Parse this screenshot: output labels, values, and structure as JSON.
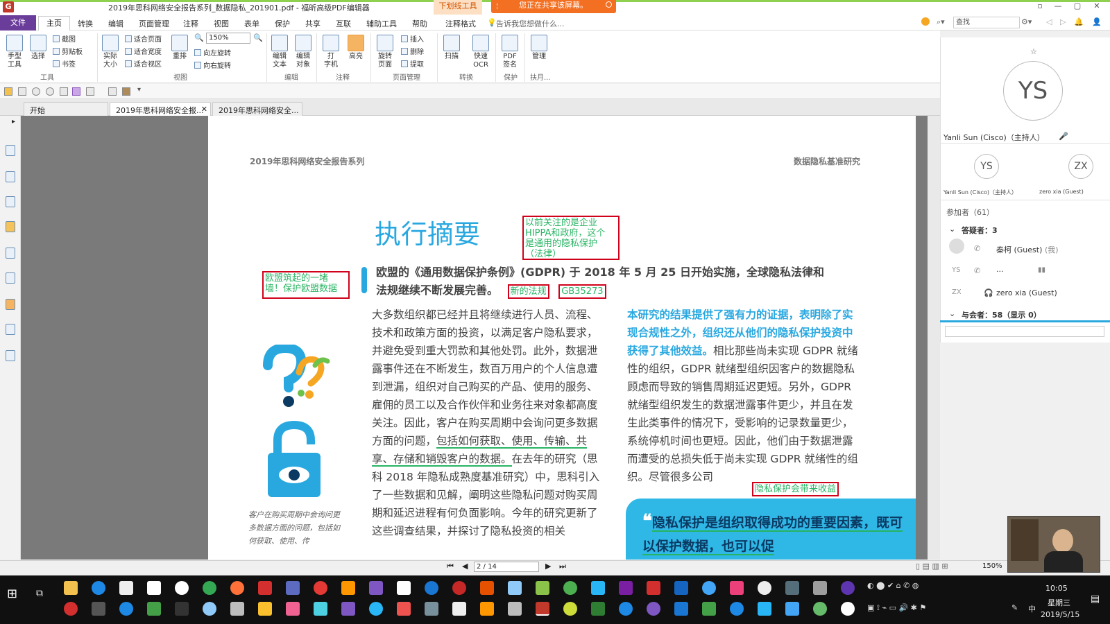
{
  "window": {
    "title": "2019年思科网络安全报告系列_数据隐私_201901.pdf - 福昕高级PDF编辑器",
    "context_tab": "下划线工具",
    "share_banner": "您正在共享该屏幕。"
  },
  "menu": {
    "file": "文件",
    "items": [
      "主页",
      "转换",
      "编辑",
      "页面管理",
      "注释",
      "视图",
      "表单",
      "保护",
      "共享",
      "互联",
      "辅助工具",
      "帮助",
      "注释格式"
    ],
    "tell_me": "告诉我您想做什么...",
    "search_placeholder": "查找"
  },
  "ribbon": {
    "hand_tool": "手型\n工具",
    "select": "选择",
    "screenshot": "截图",
    "clipboard": "剪贴板",
    "bookmark": "书签",
    "actual_size": "实际\n大小",
    "fit_page": "适合页面",
    "fit_width": "适合宽度",
    "fit_view": "适合视区",
    "reflow": "重排",
    "zoom_value": "150%",
    "rotate_left": "向左旋转",
    "rotate_right": "向右旋转",
    "edit_text": "编辑\n文本",
    "edit_object": "编辑\n对象",
    "typewriter": "打\n字机",
    "highlight": "高亮",
    "rotate_page": "旋转\n页面",
    "insert": "插入",
    "delete": "删除",
    "extract": "提取",
    "scan": "扫描",
    "quick_ocr": "快速\nOCR",
    "pdf_sign": "PDF\n签名",
    "manage": "管理",
    "groups": {
      "tools": "工具",
      "view": "视图",
      "edit": "编辑",
      "annotation": "注释",
      "page_mgmt": "页面管理",
      "convert": "转换",
      "protect": "保护",
      "extra": "扶月..."
    }
  },
  "doc_tabs": [
    "开始",
    "2019年思科网络安全报...",
    "2019年思科网络安全..."
  ],
  "page": {
    "header_left": "2019年思科网络安全报告系列",
    "header_right": "数据隐私基准研究",
    "title": "执行摘要",
    "lead_line1": "欧盟的《通用数据保护条例》(GDPR) 于 2018 年 5 月 25 日开始实施，全球隐私法律和",
    "lead_line2": "法规继续不断发展完善。",
    "annotations": {
      "top": "以前关注的是企业\nHIPPA和政府，这个\n是通用的隐私保护\n（法律）",
      "left": "欧盟筑起的一堵\n墙！保护欧盟数据",
      "new_law": "新的法规",
      "gb": "GB35273",
      "benefit": "隐私保护会带来收益"
    },
    "col1_a": "大多数组织都已经并且将继续进行人员、流程、技术和政策方面的投资，以满足客户隐私要求，并避免受到重大罚款和其他处罚。此外，数据泄露事件还在不断发生，数百万用户的个人信息遭到泄漏，组织对自己购买的产品、使用的服务、雇佣的员工以及合作伙伴和业务往来对象都高度关注。因此，客户在购买周期中会询问更多数据方面的问题，",
    "col1_underlined": "包括如何获取、使用、传输、共享、存储和销毁客户的数据。",
    "col1_b": "在去年的研究（思科 2018 年隐私成熟度基准研究）中，思科引入了一些数据和见解，阐明这些隐私问题对购买周期和延迟进程有何负面影响。今年的研究更新了这些调查结果，并探讨了隐私投资的相关",
    "col2_lead": "本研究的结果提供了强有力的证据，表明除了实现合规性之外，组织还从他们的隐私保护投资中获得了其他效益。",
    "col2_body": "相比那些尚未实现 GDPR 就绪性的组织，GDPR 就绪型组织因客户的数据隐私顾虑而导致的销售周期延迟更短。另外，GDPR 就绪型组织发生的数据泄露事件更少，并且在发生此类事件的情况下，受影响的记录数量更少，系统停机时间也更短。因此，他们由于数据泄露而遭受的总损失低于尚未实现 GDPR 就绪性的组织。尽管很多公司",
    "quote": "隐私保护是组织取得成功的重要因素，既可以保护数据，也可以促",
    "caption": "客户在购买周期中会询问更多数据方面的问题，包括如何获取、使用、传"
  },
  "status": {
    "page_field": "2 / 14",
    "zoom": "150%"
  },
  "meeting": {
    "host_initials": "YS",
    "host_name": "Yanli Sun (Cisco)（主持人）",
    "tile1_initials": "YS",
    "tile1_name": "Yanli Sun (Cisco)（主持人）",
    "tile2_initials": "ZX",
    "tile2_name": "zero xia (Guest)",
    "participants": "参加者（61）",
    "panelists": "答疑者：3",
    "p1_name": "秦柯 (Guest)",
    "p1_me": "(我)",
    "p2_initials": "YS",
    "p2_name": "...",
    "p3_initials": "ZX",
    "p3_name": "zero xia (Guest)",
    "attendees": "与会者：58（显示 0）"
  },
  "taskbar": {
    "time": "10:05",
    "weekday": "星期三",
    "date": "2019/5/15",
    "ime": "中"
  },
  "colors": {
    "accent_blue": "#29a8e0",
    "annot_red": "#d0021b",
    "annot_green": "#28b463",
    "file_purple": "#6a3d9a",
    "share_orange": "#f36f21"
  }
}
